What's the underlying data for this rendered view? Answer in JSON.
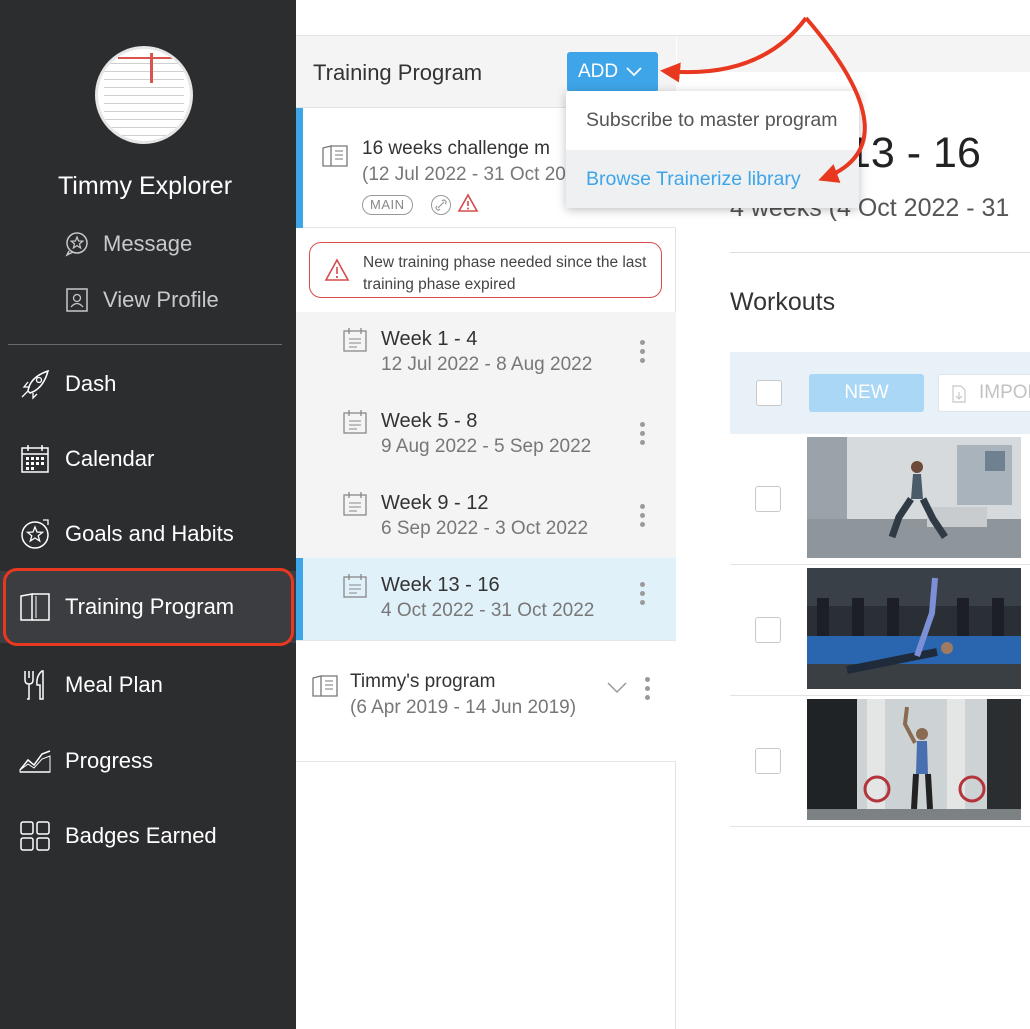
{
  "sidebar": {
    "user_name": "Timmy Explorer",
    "links": [
      {
        "label": "Message",
        "icon": "chat-star-icon"
      },
      {
        "label": "View Profile",
        "icon": "profile-card-icon"
      }
    ],
    "nav": [
      {
        "label": "Dash",
        "icon": "rocket-icon"
      },
      {
        "label": "Calendar",
        "icon": "calendar-icon"
      },
      {
        "label": "Goals and Habits",
        "icon": "goal-star-icon"
      },
      {
        "label": "Training Program",
        "icon": "book-icon",
        "active": true
      },
      {
        "label": "Meal Plan",
        "icon": "fork-knife-icon"
      },
      {
        "label": "Progress",
        "icon": "chart-icon"
      },
      {
        "label": "Badges Earned",
        "icon": "grid-icon"
      }
    ]
  },
  "middle": {
    "title": "Training Program",
    "add_label": "ADD",
    "program": {
      "title": "16 weeks challenge m",
      "dates": "(12 Jul 2022 - 31 Oct 20",
      "tag": "MAIN"
    },
    "alert": "New training phase needed since the last training phase expired",
    "weeks": [
      {
        "title": "Week 1 - 4",
        "dates": "12 Jul 2022 - 8 Aug 2022"
      },
      {
        "title": "Week 5 - 8",
        "dates": "9 Aug 2022 - 5 Sep 2022"
      },
      {
        "title": "Week 9 - 12",
        "dates": "6 Sep 2022 - 3 Oct 2022"
      },
      {
        "title": "Week 13 - 16",
        "dates": "4 Oct 2022 - 31 Oct 2022",
        "selected": true
      }
    ],
    "program2": {
      "title": "Timmy's program",
      "dates": "(6 Apr 2019 - 14 Jun 2019)"
    }
  },
  "dropdown": {
    "items": [
      "Subscribe to master program",
      "Browse Trainerize library"
    ]
  },
  "right": {
    "title": "13 - 16",
    "subtitle": "4 weeks (4 Oct 2022 - 31",
    "workouts_heading": "Workouts",
    "new_label": "NEW",
    "import_label": "IMPOR"
  },
  "colors": {
    "accent": "#3ea5e8",
    "sidebar_bg": "#2c2d2f",
    "annotation": "#e8381f",
    "alert": "#d64b4b"
  }
}
